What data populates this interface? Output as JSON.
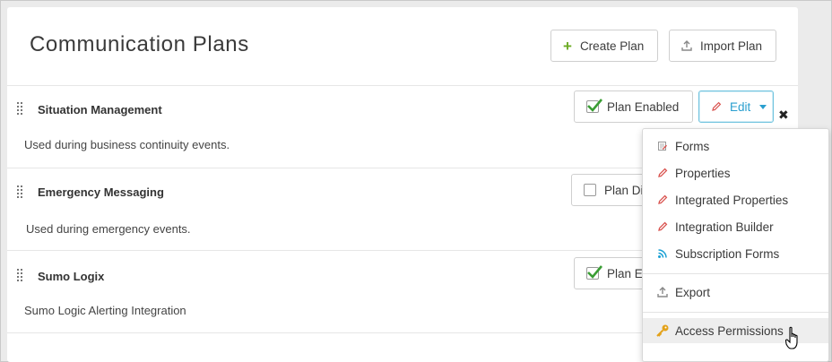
{
  "header": {
    "title": "Communication Plans",
    "create_label": "Create Plan",
    "import_label": "Import Plan"
  },
  "plans": [
    {
      "name": "Situation Management",
      "description": "Used during business continuity events.",
      "status_label": "Plan Enabled",
      "enabled": true
    },
    {
      "name": "Emergency Messaging",
      "description": "Used during emergency events.",
      "status_label": "Plan Di",
      "enabled": false
    },
    {
      "name": "Sumo Logix",
      "description": "Sumo Logic Alerting Integration",
      "status_label": "Plan E",
      "enabled": true
    }
  ],
  "edit_button": {
    "label": "Edit"
  },
  "dropdown": {
    "items": [
      {
        "label": "Forms",
        "icon": "forms-icon"
      },
      {
        "label": "Properties",
        "icon": "pencil-icon"
      },
      {
        "label": "Integrated Properties",
        "icon": "pencil-icon"
      },
      {
        "label": "Integration Builder",
        "icon": "pencil-icon"
      },
      {
        "label": "Subscription Forms",
        "icon": "rss-icon"
      },
      {
        "label": "Export",
        "icon": "export-icon"
      },
      {
        "label": "Access Permissions",
        "icon": "key-icon"
      }
    ]
  },
  "colors": {
    "accent": "#2a9fcf",
    "add_green": "#6cab25",
    "pencil_red": "#d9534f",
    "rss_blue": "#1aa0d4",
    "key_gold": "#e3a21a"
  }
}
